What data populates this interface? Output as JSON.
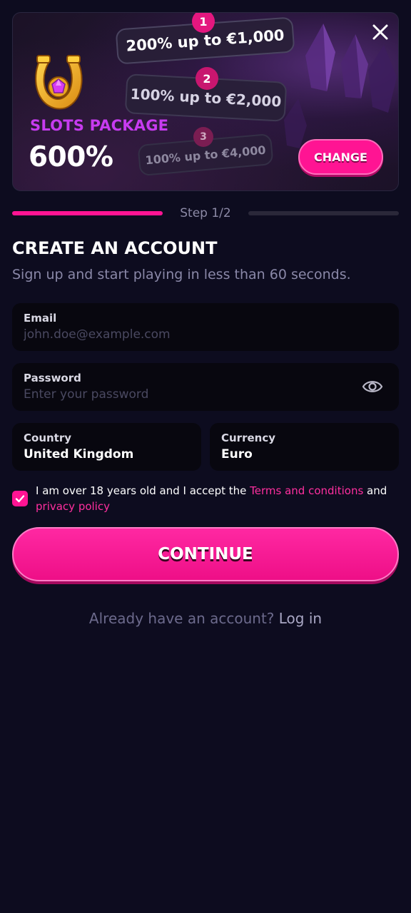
{
  "banner": {
    "tiers": [
      {
        "number": "1",
        "label": "200% up to €1,000"
      },
      {
        "number": "2",
        "label": "100% up to €2,000"
      },
      {
        "number": "3",
        "label": "100% up to €4,000"
      }
    ],
    "package_label": "SLOTS PACKAGE",
    "package_value": "600%",
    "change_label": "CHANGE"
  },
  "step": {
    "label": "Step 1/2",
    "current": 1,
    "total": 2
  },
  "form": {
    "title": "CREATE AN ACCOUNT",
    "subtitle": "Sign up and start playing in less than 60 seconds.",
    "email": {
      "label": "Email",
      "placeholder": "john.doe@example.com",
      "value": ""
    },
    "password": {
      "label": "Password",
      "placeholder": "Enter your password",
      "value": ""
    },
    "country": {
      "label": "Country",
      "value": "United Kingdom"
    },
    "currency": {
      "label": "Currency",
      "value": "Euro"
    },
    "terms": {
      "checked": true,
      "prefix": "I am over 18 years old and I accept the ",
      "terms_link": "Terms and conditions",
      "middle": " and ",
      "privacy_link": "privacy policy"
    },
    "continue_label": "CONTINUE"
  },
  "footer": {
    "prompt": "Already have an account?",
    "login_link": "Log in"
  },
  "colors": {
    "accent": "#ff1493",
    "background": "#0d0c1f",
    "field_bg": "#08070f",
    "package_label": "#c73bf0"
  }
}
